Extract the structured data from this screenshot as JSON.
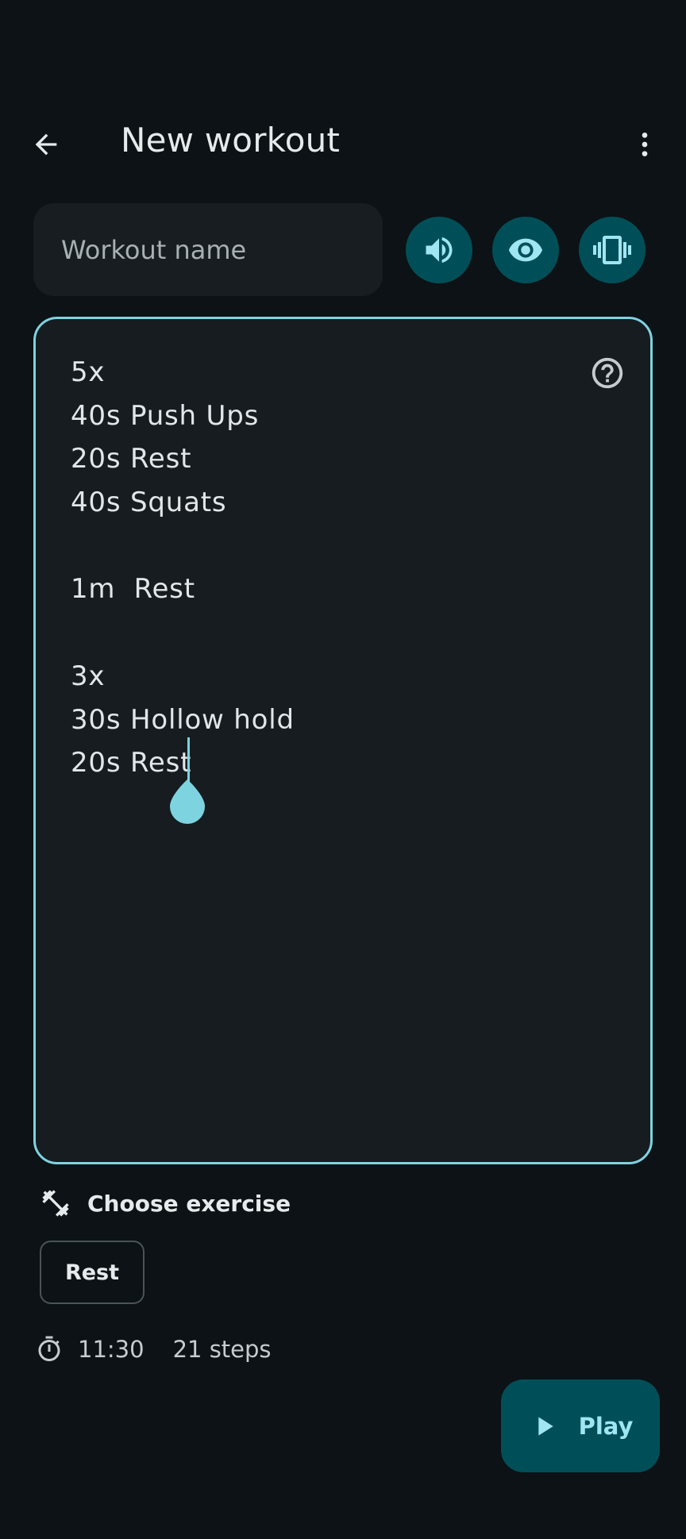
{
  "header": {
    "title": "New workout",
    "back_icon": "arrow-left-icon",
    "menu_icon": "more-vertical-icon"
  },
  "name_field": {
    "placeholder": "Workout name",
    "value": ""
  },
  "toggles": [
    {
      "name": "sound",
      "icon": "volume-icon"
    },
    {
      "name": "visual",
      "icon": "eye-icon"
    },
    {
      "name": "vibration",
      "icon": "vibrate-icon"
    }
  ],
  "editor": {
    "help_icon": "help-icon",
    "lines": [
      "5x",
      "40s Push Ups",
      "20s Rest",
      "40s Squats",
      "",
      "1m  Rest",
      "",
      "3x",
      "30s Hollow hold",
      "20s Rest"
    ]
  },
  "choose_exercise": {
    "label": "Choose exercise",
    "icon": "fitness-icon"
  },
  "chips": [
    {
      "label": "Rest"
    }
  ],
  "stats": {
    "icon": "timer-icon",
    "duration": "11:30",
    "steps": "21 steps"
  },
  "play_button": {
    "label": "Play",
    "icon": "play-icon"
  },
  "colors": {
    "background": "#0c1215",
    "surface": "#171d21",
    "accent": "#7ed3e0",
    "toggle_bg": "#004f58"
  }
}
